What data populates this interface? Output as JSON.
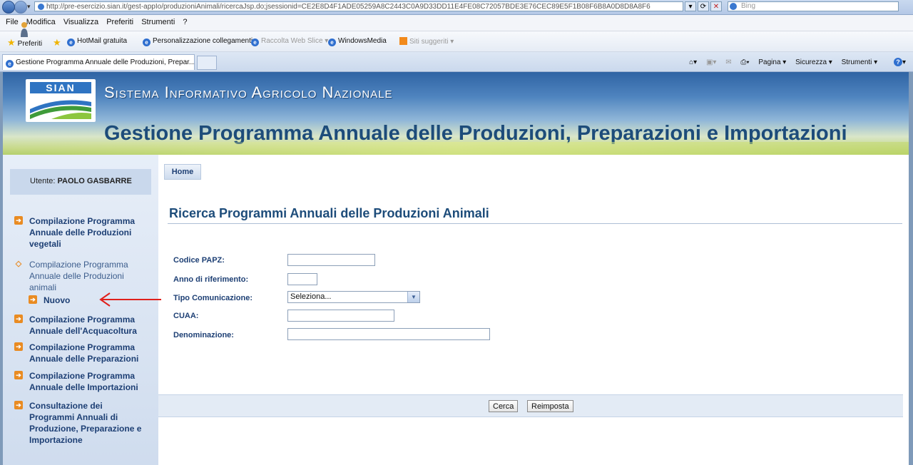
{
  "browser": {
    "url": "http://pre-esercizio.sian.it/gest-appIo/produzioniAnimali/ricercaJsp.do;jsessionid=CE2E8D4F1ADE05259A8C2443C0A9D33DD11E4FE08C72057BDE3E76CEC89E5F1B08F6B8A0D8D8A8F6",
    "search_placeholder": "Bing",
    "menu": [
      "File",
      "Modifica",
      "Visualizza",
      "Preferiti",
      "Strumenti",
      "?"
    ],
    "favorites": {
      "label": "Preferiti",
      "items": [
        "HotMail gratuita",
        "Personalizzazione collegamenti",
        "Raccolta Web Slice ▾",
        "WindowsMedia",
        "Siti suggeriti ▾"
      ]
    },
    "tab_title": "Gestione Programma Annuale delle Produzioni, Prepar...",
    "command_bar": [
      "Pagina ▾",
      "Sicurezza ▾",
      "Strumenti ▾"
    ]
  },
  "header": {
    "logo_text": "SIAN",
    "system_name": "Sistema Informativo Agricolo Nazionale",
    "app_title": "Gestione Programma Annuale delle Produzioni, Preparazioni e Importazioni"
  },
  "user": {
    "label": "Utente:",
    "name": "PAOLO GASBARRE"
  },
  "sidebar": {
    "items": [
      {
        "label": "Compilazione Programma Annuale delle Produzioni vegetali"
      },
      {
        "label": "Compilazione Programma Annuale delle Produzioni animali"
      },
      {
        "label": "Nuovo"
      },
      {
        "label": "Compilazione Programma Annuale dell'Acquacoltura"
      },
      {
        "label": "Compilazione Programma Annuale delle Preparazioni"
      },
      {
        "label": "Compilazione Programma Annuale delle Importazioni"
      },
      {
        "label": "Consultazione dei Programmi Annuali di Produzione, Preparazione e Importazione"
      }
    ]
  },
  "breadcrumb": {
    "home": "Home"
  },
  "page": {
    "title": "Ricerca Programmi Annuali delle Produzioni Animali"
  },
  "form": {
    "codice_papz": {
      "label": "Codice PAPZ:",
      "value": ""
    },
    "anno": {
      "label": "Anno di riferimento:",
      "value": ""
    },
    "tipo": {
      "label": "Tipo Comunicazione:",
      "selected": "Seleziona..."
    },
    "cuaa": {
      "label": "CUAA:",
      "value": ""
    },
    "denominazione": {
      "label": "Denominazione:",
      "value": ""
    }
  },
  "actions": {
    "search": "Cerca",
    "reset": "Reimposta"
  },
  "colors": {
    "accent": "#1d4c7a",
    "menu_icon": "#e98b22",
    "annotation": "#e0201c"
  }
}
